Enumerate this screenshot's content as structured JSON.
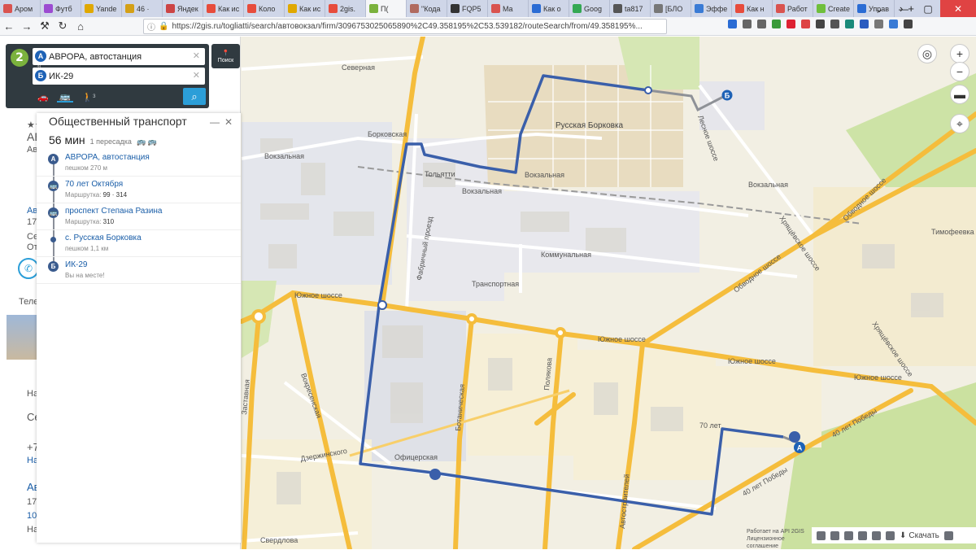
{
  "browser": {
    "tabs": [
      {
        "label": "Аром",
        "color": "#d9534f"
      },
      {
        "label": "Футб",
        "color": "#9c4bd1"
      },
      {
        "label": "Yande",
        "color": "#e0a800"
      },
      {
        "label": "46 ·",
        "color": "#d4a017"
      },
      {
        "label": "Яндек",
        "color": "#cc4444"
      },
      {
        "label": "Как ис",
        "color": "#e74c3c"
      },
      {
        "label": "Коло",
        "color": "#e74c3c"
      },
      {
        "label": "Как ис",
        "color": "#e0a800"
      },
      {
        "label": "2gis.",
        "color": "#e74c3c"
      },
      {
        "label": "П(",
        "color": "#7bb23d"
      },
      {
        "label": "\"Кода",
        "color": "#b06a5f"
      },
      {
        "label": "FQP5",
        "color": "#333333"
      },
      {
        "label": "Ma",
        "color": "#d9534f"
      },
      {
        "label": "Как о",
        "color": "#2b6cd4"
      },
      {
        "label": "Goog",
        "color": "#34a853"
      },
      {
        "label": "ta817",
        "color": "#555555"
      },
      {
        "label": "[БЛО",
        "color": "#777777"
      },
      {
        "label": "Эффе",
        "color": "#3a7bd5"
      },
      {
        "label": "Как н",
        "color": "#e74c3c"
      },
      {
        "label": "Работ",
        "color": "#d9534f"
      },
      {
        "label": "Create",
        "color": "#6fbf3c"
      },
      {
        "label": "Управ",
        "color": "#2b6cd4"
      }
    ],
    "url": "https://2gis.ru/togliatti/search/автовокзал/firm/3096753025065890%2C49.358195%2C53.539182/routeSearch/from/49.358195%..."
  },
  "search": {
    "from_badge": "А",
    "from_value": "АВРОРА, автостанция",
    "to_badge": "Б",
    "to_value": "ИК-29",
    "walk_count": "3",
    "poisk_label": "Поиск"
  },
  "route_card": {
    "title": "Общественный транспорт",
    "duration": "56 мин",
    "transfers": "1 пересадка",
    "steps": [
      {
        "badge": "А",
        "name": "АВРОРА, автостанция",
        "sub_prefix": "пешком 270 м",
        "sub_value": ""
      },
      {
        "badge": "🚌",
        "name": "70 лет Октября",
        "sub_prefix": "Маршрутка: ",
        "sub_value": "99 · 314"
      },
      {
        "badge": "🚌",
        "name": "проспект Степана Разина",
        "sub_prefix": "Маршрутка: ",
        "sub_value": "310"
      },
      {
        "badge": "",
        "name": "с. Русская Борковка",
        "sub_prefix": "пешком 1,1 км",
        "sub_value": ""
      },
      {
        "badge": "Б",
        "name": "ИК-29",
        "sub_prefix": "Вы на месте!",
        "sub_value": ""
      }
    ]
  },
  "background_panel": {
    "lines": [
      "★★",
      "АЕ",
      "Авто",
      "Авто",
      "17-",
      "Сев",
      "Отк",
      "Телеф",
      "Наг",
      "Сев",
      "+7",
      "Най",
      "Авт",
      "17-",
      "10",
      "Наг"
    ]
  },
  "map_labels": {
    "severnaya": "Северная",
    "borkovskaya": "Борковская",
    "vokzalnaya": "Вокзальная",
    "vokzalnaya2": "Вокзальная",
    "vokzalnaya3": "Вокзальная",
    "togliatti": "Тольятти",
    "russkaya_borkovka": "Русская Борковка",
    "kommunalnaya": "Коммунальная",
    "transportnaya": "Транспортная",
    "fabrichny": "Фабричный проезд",
    "yuzhnoe1": "Южное шоссе",
    "yuzhnoe2": "Южное шоссе",
    "yuzhnoe3": "Южное шоссе",
    "yuzhnoe4": "Южное шоссе",
    "obvodnoe1": "Обводное шоссе",
    "obvodnoe2": "Обводное шоссе",
    "hryashchevskoe": "Хрящёвское шоссе",
    "hryashchevskoe2": "Хрящёвское шоссе",
    "timofeevka": "Тимофеевка",
    "zastavnaya": "Заставная",
    "voskresenskaya": "Вокресенская",
    "botanicheskaya": "Ботаническая",
    "polyakova": "Полякова",
    "dzerzhinskogo": "Дзержинского",
    "oficerskaya": "Офицерская",
    "avtostroiteley": "Автостроителей",
    "let70": "70 лет",
    "pobedy1": "40 лет Победы",
    "pobedy2": "40 лет Победы",
    "sverdlova": "Свердлова",
    "dosoe": "Лесное шоссе"
  },
  "bottom": {
    "download_label": "Скачать",
    "api_text": "Работает на API 2GIS",
    "license_text": "Лицензионное соглашение"
  }
}
